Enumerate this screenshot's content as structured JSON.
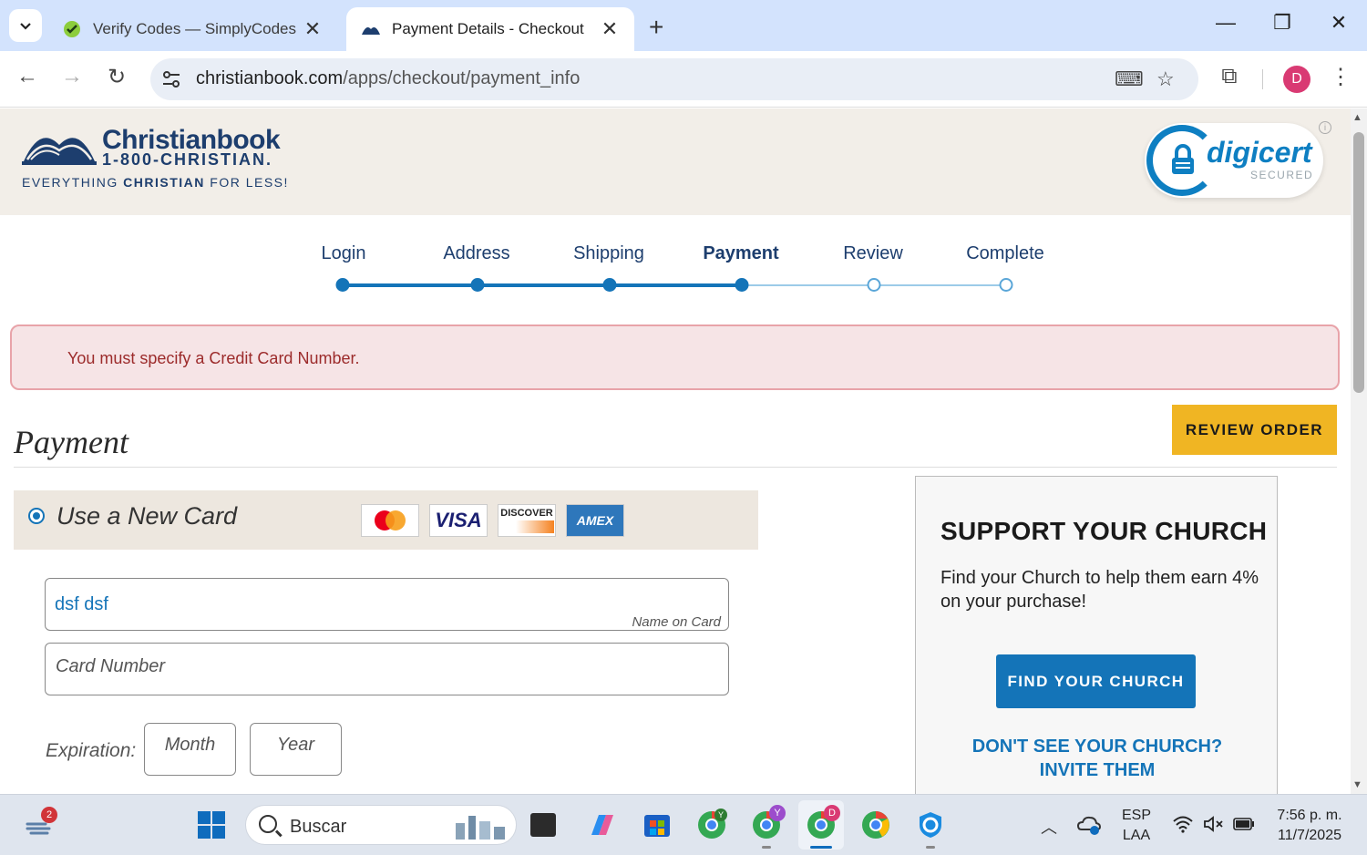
{
  "browser": {
    "tabs": [
      {
        "title": "Verify Codes — SimplyCodes",
        "active": false
      },
      {
        "title": "Payment Details - Checkout",
        "active": true
      }
    ],
    "url_domain": "christianbook.com",
    "url_path": "/apps/checkout/payment_info",
    "profile_initial": "D"
  },
  "header": {
    "logo_name": "Christianbook",
    "logo_phone": "1-800-CHRISTIAN.",
    "tagline_pre": "EVERYTHING ",
    "tagline_bold": "CHRISTIAN",
    "tagline_post": " FOR LESS!",
    "digicert_brand": "digicert",
    "digicert_secured": "SECURED",
    "info_icon": "i"
  },
  "steps": [
    {
      "label": "Login",
      "state": "done"
    },
    {
      "label": "Address",
      "state": "done"
    },
    {
      "label": "Shipping",
      "state": "done"
    },
    {
      "label": "Payment",
      "state": "current"
    },
    {
      "label": "Review",
      "state": "todo"
    },
    {
      "label": "Complete",
      "state": "todo"
    }
  ],
  "alert": {
    "message": "You must specify a Credit Card Number."
  },
  "review_button": "REVIEW ORDER",
  "payment": {
    "title": "Payment",
    "new_card_label": "Use a New Card",
    "cards": {
      "mastercard": "MASTERCARD",
      "visa": "VISA",
      "discover": "DISCOVER",
      "amex": "AMEX"
    },
    "name_on_card": {
      "value": "dsf dsf",
      "hint": "Name on Card"
    },
    "card_number": {
      "placeholder": "Card Number"
    },
    "expiration_label": "Expiration:",
    "month_placeholder": "Month",
    "year_placeholder": "Year"
  },
  "church": {
    "title": "SUPPORT YOUR CHURCH",
    "body": "Find your Church to help them earn 4% on your purchase!",
    "find_button": "FIND YOUR CHURCH",
    "invite_line1": "DON'T SEE YOUR CHURCH?",
    "invite_line2": "INVITE THEM"
  },
  "taskbar": {
    "search_label": "Buscar",
    "weather_badge": "2",
    "lang_line1": "ESP",
    "lang_line2": "LAA",
    "time": "7:56 p. m.",
    "date": "11/7/2025",
    "chrome_badge_y": "Y",
    "chrome_badge_v": "Y",
    "chrome_badge_d": "D"
  },
  "colors": {
    "brand_blue": "#1474b8",
    "accent_gold": "#f0b523",
    "alert_bg": "#f6e4e6",
    "alert_text": "#9c2b2b"
  }
}
